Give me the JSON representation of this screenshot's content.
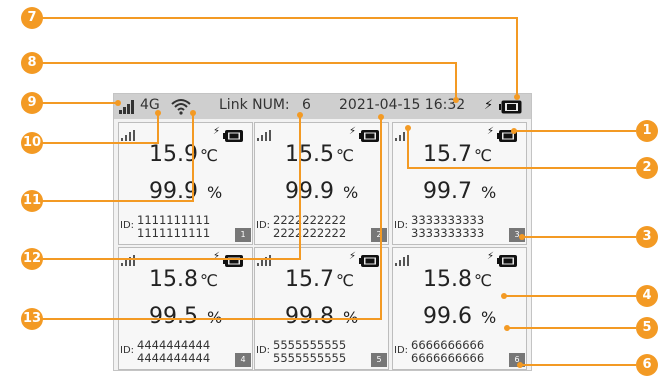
{
  "status_bar": {
    "network": "4G",
    "link_label": "Link NUM:",
    "link_count": "6",
    "datetime": "2021-04-15 16:32"
  },
  "panels": [
    {
      "temp": "15.9",
      "temp_unit": "℃",
      "hum": "99.9",
      "hum_unit": "%",
      "id_label": "ID:",
      "id_line1": "1111111111",
      "id_line2": "1111111111",
      "num": "1"
    },
    {
      "temp": "15.5",
      "temp_unit": "℃",
      "hum": "99.9",
      "hum_unit": "%",
      "id_label": "ID:",
      "id_line1": "2222222222",
      "id_line2": "2222222222",
      "num": "2"
    },
    {
      "temp": "15.7",
      "temp_unit": "℃",
      "hum": "99.7",
      "hum_unit": "%",
      "id_label": "ID:",
      "id_line1": "3333333333",
      "id_line2": "3333333333",
      "num": "3"
    },
    {
      "temp": "15.8",
      "temp_unit": "℃",
      "hum": "99.5",
      "hum_unit": "%",
      "id_label": "ID:",
      "id_line1": "4444444444",
      "id_line2": "4444444444",
      "num": "4"
    },
    {
      "temp": "15.7",
      "temp_unit": "℃",
      "hum": "99.8",
      "hum_unit": "%",
      "id_label": "ID:",
      "id_line1": "5555555555",
      "id_line2": "5555555555",
      "num": "5"
    },
    {
      "temp": "15.8",
      "temp_unit": "℃",
      "hum": "99.6",
      "hum_unit": "%",
      "id_label": "ID:",
      "id_line1": "6666666666",
      "id_line2": "6666666666",
      "num": "6"
    }
  ],
  "callouts": [
    "1",
    "2",
    "3",
    "4",
    "5",
    "6",
    "7",
    "8",
    "9",
    "10",
    "11",
    "12",
    "13"
  ],
  "colors": {
    "callout": "#f39a24",
    "status_bar": "#cfcfcf",
    "panel": "#f7f7f7",
    "badge": "#777777"
  },
  "icons": [
    "signal-icon",
    "wifi-icon",
    "battery-icon",
    "charging-bolt-icon"
  ]
}
